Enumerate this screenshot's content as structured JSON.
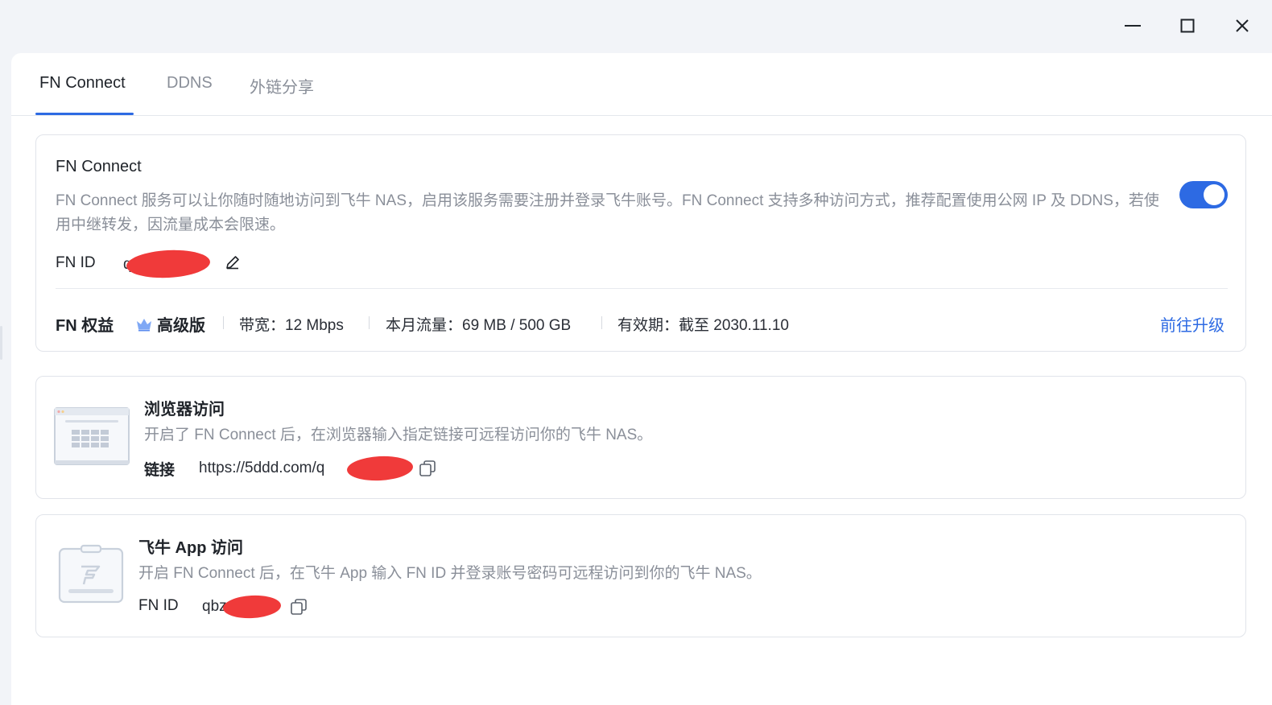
{
  "tabs": [
    {
      "label": "FN Connect",
      "active": true
    },
    {
      "label": "DDNS",
      "active": false
    },
    {
      "label": "外链分享",
      "active": false
    }
  ],
  "fn_connect": {
    "title": "FN Connect",
    "description": "FN Connect 服务可以让你随时随地访问到飞牛 NAS，启用该服务需要注册并登录飞牛账号。FN Connect 支持多种访问方式，推荐配置使用公网 IP 及 DDNS，若使用中继转发，因流量成本会限速。",
    "toggle_on": true,
    "fn_id_label": "FN ID",
    "fn_id_value": "q",
    "benefits_label": "FN 权益",
    "tier": "高级版",
    "bandwidth": "带宽：12 Mbps",
    "traffic": "本月流量：69 MB / 500 GB",
    "validity": "有效期：截至 2030.11.10",
    "upgrade_link": "前往升级"
  },
  "browser_access": {
    "title": "浏览器访问",
    "description": "开启了 FN Connect 后，在浏览器输入指定链接可远程访问你的飞牛 NAS。",
    "link_label": "链接",
    "link_value": "https://5ddd.com/q"
  },
  "app_access": {
    "title": "飞牛 App 访问",
    "description": "开启 FN Connect 后，在飞牛 App 输入 FN ID 并登录账号密码可远程访问到你的飞牛 NAS。",
    "fn_id_label": "FN ID",
    "fn_id_value": "qbz"
  },
  "colors": {
    "accent": "#2d6ae3",
    "redaction": "#f03a3a",
    "crown": "#7fa8f5"
  },
  "icons": [
    "minimize-icon",
    "maximize-icon",
    "close-icon",
    "edit-icon",
    "crown-icon",
    "copy-icon",
    "browser-illustration-icon",
    "app-illustration-icon"
  ]
}
